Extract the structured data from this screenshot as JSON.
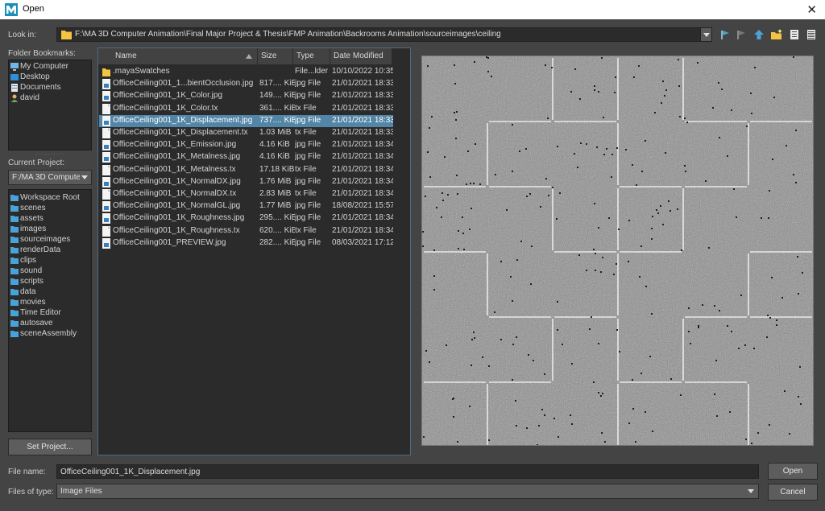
{
  "window": {
    "title": "Open",
    "close_glyph": "✕"
  },
  "lookin": {
    "label": "Look in:",
    "path": "F:\\MA 3D Computer Animation\\Final Major Project & Thesis\\FMP Animation\\Backrooms Animation\\sourceimages\\ceiling"
  },
  "toolbar": [
    "back-icon",
    "forward-icon",
    "up-folder-icon",
    "new-folder-icon",
    "list-view-icon",
    "detail-view-icon"
  ],
  "bookmarks": {
    "label": "Folder Bookmarks:",
    "items": [
      {
        "label": "My Computer",
        "icon": "computer-icon"
      },
      {
        "label": "Desktop",
        "icon": "desktop-icon"
      },
      {
        "label": "Documents",
        "icon": "documents-icon"
      },
      {
        "label": "david",
        "icon": "user-icon"
      }
    ]
  },
  "project": {
    "label": "Current Project:",
    "value": "F:/MA 3D Compute",
    "folders": [
      "Workspace Root",
      "scenes",
      "assets",
      "images",
      "sourceimages",
      "renderData",
      "clips",
      "sound",
      "scripts",
      "data",
      "movies",
      "Time Editor",
      "autosave",
      "sceneAssembly"
    ],
    "set_button": "Set Project..."
  },
  "file_list": {
    "columns": [
      "Name",
      "Size",
      "Type",
      "Date Modified"
    ],
    "selected_index": 4,
    "rows": [
      {
        "name": ".mayaSwatches",
        "size": "",
        "type": "File...lder",
        "date": "10/10/2022 10:35",
        "icon": "folder"
      },
      {
        "name": "OfficeCeiling001_1...bientOcclusion.jpg",
        "size": "817.... KiB",
        "type": "jpg File",
        "date": "21/01/2021 18:33",
        "icon": "image"
      },
      {
        "name": "OfficeCeiling001_1K_Color.jpg",
        "size": "149.... KiB",
        "type": "jpg File",
        "date": "21/01/2021 18:33",
        "icon": "image"
      },
      {
        "name": "OfficeCeiling001_1K_Color.tx",
        "size": "361.... KiB",
        "type": "tx File",
        "date": "21/01/2021 18:33",
        "icon": "file"
      },
      {
        "name": "OfficeCeiling001_1K_Displacement.jpg",
        "size": "737.... KiB",
        "type": "jpg File",
        "date": "21/01/2021 18:33",
        "icon": "image"
      },
      {
        "name": "OfficeCeiling001_1K_Displacement.tx",
        "size": "1.03 MiB",
        "type": "tx File",
        "date": "21/01/2021 18:33",
        "icon": "file"
      },
      {
        "name": "OfficeCeiling001_1K_Emission.jpg",
        "size": "4.16 KiB",
        "type": "jpg File",
        "date": "21/01/2021 18:34",
        "icon": "image"
      },
      {
        "name": "OfficeCeiling001_1K_Metalness.jpg",
        "size": "4.16 KiB",
        "type": "jpg File",
        "date": "21/01/2021 18:34",
        "icon": "image"
      },
      {
        "name": "OfficeCeiling001_1K_Metalness.tx",
        "size": "17.18 KiB",
        "type": "tx File",
        "date": "21/01/2021 18:34",
        "icon": "file"
      },
      {
        "name": "OfficeCeiling001_1K_NormalDX.jpg",
        "size": "1.76 MiB",
        "type": "jpg File",
        "date": "21/01/2021 18:34",
        "icon": "image"
      },
      {
        "name": "OfficeCeiling001_1K_NormalDX.tx",
        "size": "2.83 MiB",
        "type": "tx File",
        "date": "21/01/2021 18:34",
        "icon": "file"
      },
      {
        "name": "OfficeCeiling001_1K_NormalGL.jpg",
        "size": "1.77 MiB",
        "type": "jpg File",
        "date": "18/08/2021 15:57",
        "icon": "image"
      },
      {
        "name": "OfficeCeiling001_1K_Roughness.jpg",
        "size": "295.... KiB",
        "type": "jpg File",
        "date": "21/01/2021 18:34",
        "icon": "image"
      },
      {
        "name": "OfficeCeiling001_1K_Roughness.tx",
        "size": "620.... KiB",
        "type": "tx File",
        "date": "21/01/2021 18:34",
        "icon": "file"
      },
      {
        "name": "OfficeCeiling001_PREVIEW.jpg",
        "size": "282.... KiB",
        "type": "jpg File",
        "date": "08/03/2021 17:12",
        "icon": "image"
      }
    ]
  },
  "footer": {
    "filename_label": "File name:",
    "filename_value": "OfficeCeiling001_1K_Displacement.jpg",
    "filetype_label": "Files of type:",
    "filetype_value": "Image Files",
    "open_button": "Open",
    "cancel_button": "Cancel"
  },
  "colors": {
    "accent": "#5285a6",
    "background": "#444444",
    "panel": "#2b2b2b"
  }
}
